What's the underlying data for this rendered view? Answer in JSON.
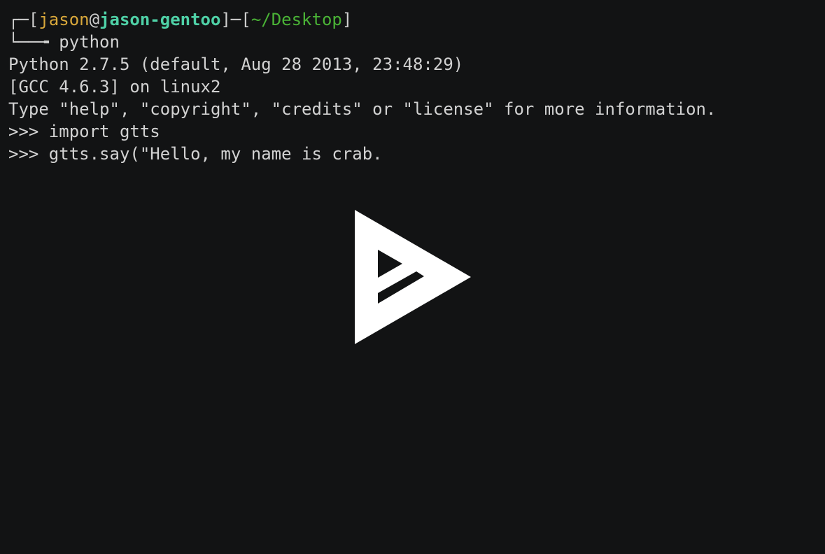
{
  "prompt": {
    "top_left": "┌─[",
    "user": "jason",
    "at": "@",
    "host": "jason-gentoo",
    "sep": "]─[",
    "path": "~/Desktop",
    "close": "]",
    "bottom_left": "└──╼",
    "command": " python"
  },
  "output": [
    "Python 2.7.5 (default, Aug 28 2013, 23:48:29)",
    "[GCC 4.6.3] on linux2",
    "Type \"help\", \"copyright\", \"credits\" or \"license\" for more information.",
    ">>> import gtts",
    ">>> gtts.say(\"Hello, my name is crab."
  ],
  "overlay": {
    "icon": "asciinema-play-icon",
    "color": "#ffffff"
  },
  "colors": {
    "background": "#121314",
    "text": "#d2d2d2",
    "user": "#d9a83b",
    "host": "#4fd1a7",
    "path": "#4ab336"
  }
}
